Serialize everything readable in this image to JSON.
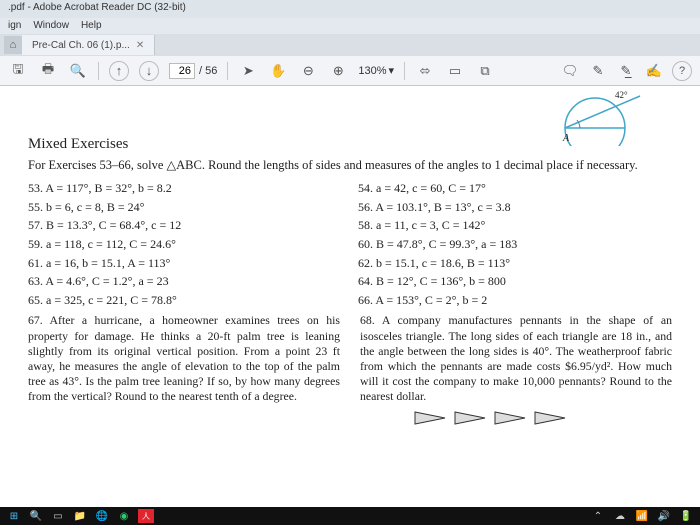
{
  "app": {
    "title": ".pdf - Adobe Acrobat Reader DC (32-bit)",
    "menu": [
      "ign",
      "Window",
      "Help"
    ],
    "tab_home_icon": "⌂",
    "tab_label": "Pre-Cal Ch. 06 (1).p...",
    "page_current": "26",
    "page_total": "/ 56",
    "zoom": "130%",
    "help_icon": "?"
  },
  "icons": {
    "save": "🖫",
    "print": "🖶",
    "mag": "🔍",
    "up": "↑",
    "down": "↓",
    "hand": "✋",
    "minus": "⊖",
    "plus": "⊕",
    "caret": "▾",
    "ruler": "⟟",
    "scroll": "⧉",
    "page": "▭",
    "comment": "🗨",
    "pen": "✎",
    "highlight": "✎̲",
    "sign": "✍"
  },
  "diagram": {
    "angle_label": "42°",
    "point_label": "A"
  },
  "heading": "Mixed Exercises",
  "instructions": "For Exercises 53–66, solve △ABC. Round the lengths of sides and measures of the angles to 1 decimal place if necessary.",
  "left": {
    "53": "53. A = 117°, B = 32°, b = 8.2",
    "55": "55. b = 6, c = 8, B = 24°",
    "57": "57. B = 13.3°, C = 68.4°, c = 12",
    "59": "59. a = 118, c = 112, C = 24.6°",
    "61": "61. a = 16, b = 15.1, A = 113°",
    "63": "63. A = 4.6°, C = 1.2°, a = 23",
    "65": "65. a = 325, c = 221, C = 78.8°"
  },
  "right": {
    "54": "54. a = 42, c = 60, C = 17°",
    "56": "56. A = 103.1°, B = 13°, c = 3.8",
    "58": "58. a = 11, c = 3, C = 142°",
    "60": "60. B = 47.8°, C = 99.3°, a = 183",
    "62": "62. b = 15.1, c = 18.6, B = 113°",
    "64": "64. B = 12°, C = 136°, b = 800",
    "66": "66. A = 153°, C = 2°, b = 2"
  },
  "w67": "67. After a hurricane, a homeowner examines trees on his property for damage. He thinks a 20-ft palm tree is leaning slightly from its original vertical position. From a point 23 ft away, he measures the angle of elevation to the top of the palm tree as 43°. Is the palm tree leaning? If so, by how many degrees from the vertical? Round to the nearest tenth of a degree.",
  "w68": "68. A company manufactures pennants in the shape of an isosceles triangle. The long sides of each triangle are 18 in., and the angle between the long sides is 40°. The weatherproof fabric from which the pennants are made costs $6.95/yd². How much will it cost the company to make 10,000 pennants? Round to the nearest dollar."
}
